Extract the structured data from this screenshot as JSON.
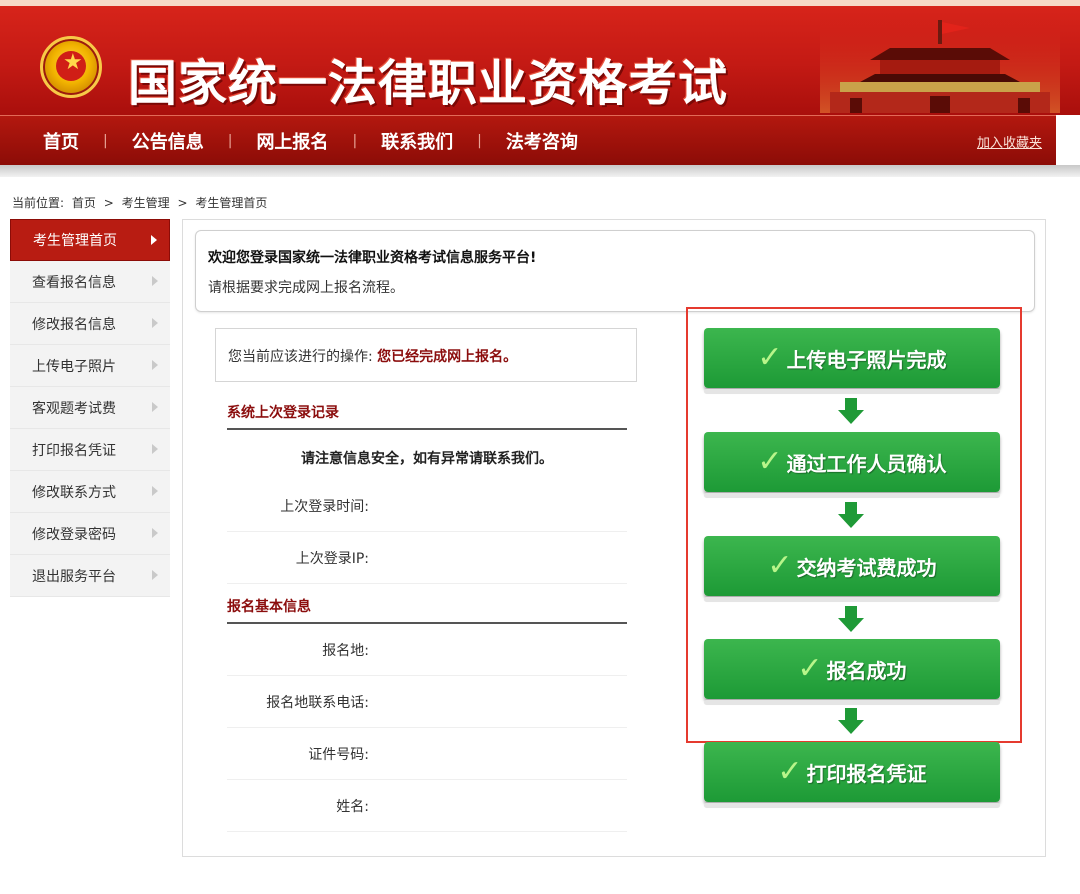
{
  "header": {
    "title": "国家统一法律职业资格考试",
    "emblem_icon": "national-emblem-icon",
    "decoration_icon": "tiananmen-gate-icon"
  },
  "nav": {
    "items": [
      {
        "label": "首页"
      },
      {
        "label": "公告信息"
      },
      {
        "label": "网上报名"
      },
      {
        "label": "联系我们"
      },
      {
        "label": "法考咨询"
      }
    ],
    "separator": "|",
    "favorite": "加入收藏夹"
  },
  "breadcrumb": {
    "prefix": "当前位置:",
    "items": [
      "首页",
      ">",
      "考生管理",
      ">",
      "考生管理首页"
    ]
  },
  "sidebar": {
    "items": [
      {
        "label": "考生管理首页",
        "active": true
      },
      {
        "label": "查看报名信息"
      },
      {
        "label": "修改报名信息"
      },
      {
        "label": "上传电子照片"
      },
      {
        "label": "客观题考试费"
      },
      {
        "label": "打印报名凭证"
      },
      {
        "label": "修改联系方式"
      },
      {
        "label": "修改登录密码"
      },
      {
        "label": "退出服务平台"
      }
    ]
  },
  "welcome": {
    "title": "欢迎您登录国家统一法律职业资格考试信息服务平台!",
    "subtitle": "请根据要求完成网上报名流程。"
  },
  "operation": {
    "label": "您当前应该进行的操作:",
    "value": "您已经完成网上报名。"
  },
  "login_record": {
    "title": "系统上次登录记录",
    "notice": "请注意信息安全，如有异常请联系我们。",
    "fields": [
      {
        "label": "上次登录时间:",
        "value": ""
      },
      {
        "label": "上次登录IP:",
        "value": ""
      }
    ]
  },
  "basic_info": {
    "title": "报名基本信息",
    "fields": [
      {
        "label": "报名地:",
        "value": ""
      },
      {
        "label": "报名地联系电话:",
        "value": ""
      },
      {
        "label": "证件号码:",
        "value": ""
      },
      {
        "label": "姓名:",
        "value": ""
      }
    ]
  },
  "flow": {
    "steps": [
      {
        "label": "上传电子照片完成"
      },
      {
        "label": "通过工作人员确认"
      },
      {
        "label": "交纳考试费成功"
      },
      {
        "label": "报名成功"
      },
      {
        "label": "打印报名凭证"
      }
    ],
    "check_icon": "checkmark-icon",
    "arrow_icon": "down-arrow-icon",
    "highlight_color": "#e53a2f",
    "step_color": "#2aa843"
  },
  "colors": {
    "brand_red": "#c41a14",
    "accent_dark_red": "#8b0d0d"
  }
}
